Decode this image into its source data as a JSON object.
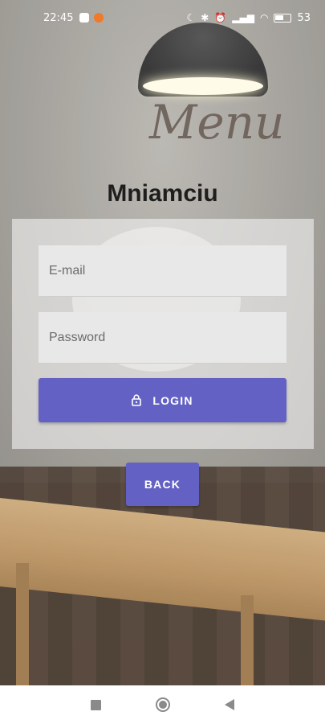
{
  "status_bar": {
    "time": "22:45",
    "battery": "53",
    "icons": [
      "notification-icon",
      "app-icon",
      "moon-icon",
      "bluetooth-icon",
      "alarm-icon",
      "signal-icon",
      "wifi-icon",
      "battery-icon"
    ]
  },
  "app": {
    "title": "Mniamciu"
  },
  "login_form": {
    "email_placeholder": "E-mail",
    "email_value": "",
    "password_placeholder": "Password",
    "password_value": "",
    "login_label": "LOGIN",
    "login_icon": "lock-icon"
  },
  "back_button": {
    "label": "BACK"
  },
  "nav_bar": {
    "icons": [
      "recents-icon",
      "home-icon",
      "back-icon"
    ]
  },
  "colors": {
    "accent": "#6362c4",
    "field_bg": "#e8e8e8",
    "title": "#1e1e1e"
  }
}
